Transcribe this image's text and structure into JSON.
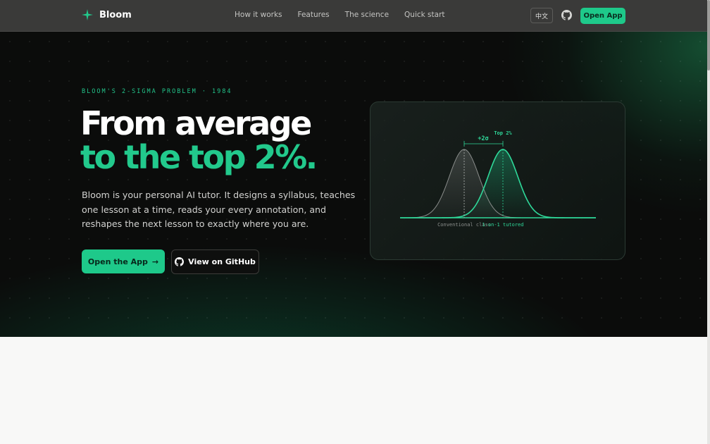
{
  "nav": {
    "brand": "Bloom",
    "links": [
      "How it works",
      "Features",
      "The science",
      "Quick start"
    ],
    "lang": "中文",
    "cta": "Open App"
  },
  "hero": {
    "eyebrow": "BLOOM'S 2-SIGMA PROBLEM · 1984",
    "title_line1": "From average",
    "title_line2": "to the top 2%.",
    "description": "Bloom is your personal AI tutor. It designs a syllabus, teaches one lesson at a time, reads your every annotation, and reshapes the next lesson to exactly where you are.",
    "primary_button": "Open the App",
    "secondary_button": "View on GitHub"
  },
  "chart": {
    "label_shift": "+2σ",
    "label_top": "Top 2%",
    "label_left": "Conventional class",
    "label_right": "1-on-1 tutored"
  },
  "colors": {
    "accent": "#1ec98a",
    "nav_bg": "#3a3a39",
    "hero_bg": "#0b0c0b"
  }
}
